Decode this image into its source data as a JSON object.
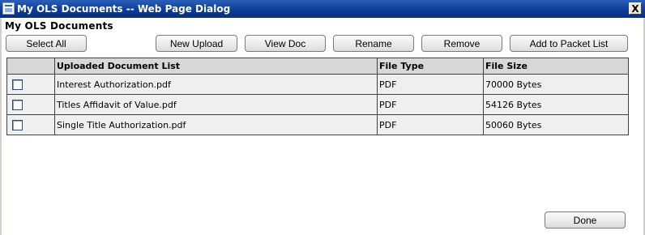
{
  "window": {
    "title": "My OLS Documents -- Web Page Dialog",
    "close_glyph": "X"
  },
  "heading": "My OLS Documents",
  "toolbar": {
    "select_all": "Select All",
    "new_upload": "New Upload",
    "view_doc": "View Doc",
    "rename": "Rename",
    "remove": "Remove",
    "add_to_packet": "Add to Packet List"
  },
  "table": {
    "columns": [
      "",
      "Uploaded Document List",
      "File Type",
      "File Size"
    ],
    "rows": [
      {
        "checked": false,
        "name": "Interest Authorization.pdf",
        "type": "PDF",
        "size": "70000 Bytes"
      },
      {
        "checked": false,
        "name": "Titles Affidavit of Value.pdf",
        "type": "PDF",
        "size": "54126 Bytes"
      },
      {
        "checked": false,
        "name": "Single Title Authorization.pdf",
        "type": "PDF",
        "size": "50060 Bytes"
      }
    ]
  },
  "footer": {
    "done": "Done"
  }
}
